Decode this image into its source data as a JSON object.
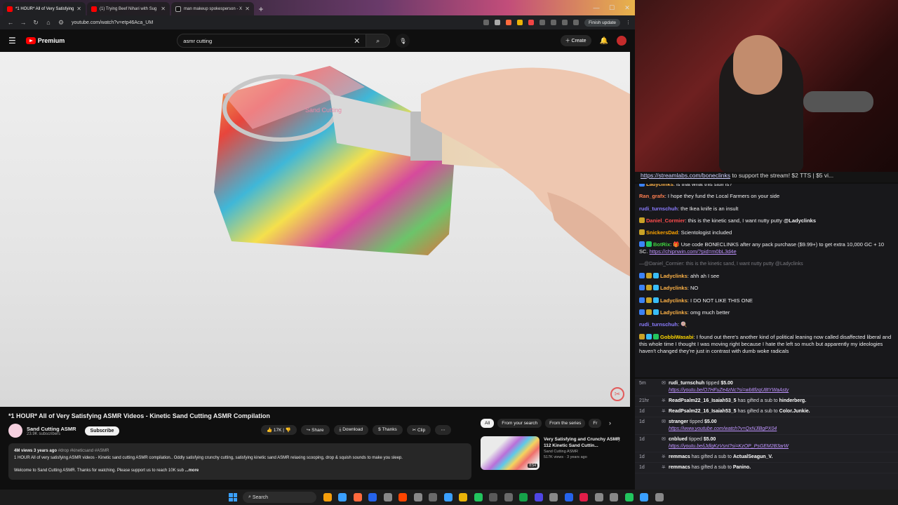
{
  "browser": {
    "tabs": [
      {
        "title": "*1 HOUR* All of Very Satisfying",
        "active": true,
        "icon": "youtube-icon"
      },
      {
        "title": "(1) Trying Beef Nihari with Sug",
        "active": false,
        "icon": "youtube-icon"
      },
      {
        "title": "man makeup spokesperson - X",
        "active": false,
        "icon": "x-icon"
      }
    ],
    "url": "youtube.com/watch?v=etp46Aca_UM",
    "finish_update": "Finish update"
  },
  "youtube": {
    "logo_text": "Premium",
    "search_value": "asmr cutting",
    "create_label": "Create"
  },
  "video": {
    "watermark": "Sand Cutting",
    "title": "*1 HOUR* All of Very Satisfying ASMR Videos - Kinetic Sand Cutting ASMR Compilation",
    "channel": "Sand Cutting ASMR",
    "subscribers": "23.9K subscribers",
    "subscribe_label": "Subscribe",
    "likes": "17K",
    "share_label": "Share",
    "download_label": "Download",
    "thanks_label": "Thanks",
    "clip_label": "Clip",
    "desc_meta": "4M views  3 years ago",
    "desc_tags": "#drop #kineticsand #ASMR",
    "desc_line1": "1 HOUR All of very satisfying ASMR videos - Kinetic sand cutting ASMR compilation.. Oddly satisfying crunchy cutting, satisfying kinetic sand ASMR relaxing scooping, drop & squish sounds to make you sleep.",
    "desc_line2": "Welcome to Sand Cutting ASMR. Thanks for watching. Please support us to reach 10K sub",
    "desc_more": "...more"
  },
  "recommended": {
    "chips": [
      "All",
      "From your search",
      "From the series",
      "Fr"
    ],
    "items": [
      {
        "title": "Very Satisfying and Crunchy ASMR 112 Kinetic Sand Cuttin...",
        "channel": "Sand Cutting ASMR",
        "meta": "517K views · 3 years ago",
        "duration": "8:54"
      }
    ]
  },
  "stream": {
    "banner_link": "https://streamlabs.com/boneclinks",
    "banner_text": " to support the stream! $2 TTS | $5 vi..."
  },
  "chat": [
    {
      "user": "Ladyclinks",
      "color": "#ffb347",
      "text": ": is that what this stuff is?",
      "badges": [
        "#3b82f6"
      ],
      "partial": true
    },
    {
      "user": "Ran_grafx",
      "color": "#ff7f50",
      "text": ": I hope they fund the Local Farmers on your side",
      "badges": []
    },
    {
      "user": "rudi_turnschuh",
      "color": "#8b7cff",
      "text": ": the Ikea knife is an insult",
      "badges": []
    },
    {
      "user": "Daniel_Cormier",
      "color": "#ff4d4d",
      "text": ": this is the kinetic sand, I want nutty putty ",
      "mention": "@Ladyclinks",
      "badges": [
        "#c9a227"
      ]
    },
    {
      "user": "SnickersDad",
      "color": "#ffa500",
      "text": ": Scientologist included",
      "badges": [
        "#c9a227"
      ]
    },
    {
      "user": "BotRix",
      "color": "#3fd13f",
      "text": ": 🎁 Use code BONECLINKS after any pack purchase ($9.99+) to get extra 10,000 GC + 10 SC. ",
      "link": "https://chipnwin.com/?pid=m0bL3d4e",
      "badges": [
        "#3b82f6",
        "#22c55e"
      ]
    },
    {
      "user": "",
      "color": "#7a7a80",
      "text": "—@Daniel_Cormier: this is the kinetic sand, I want nutty putty @Ladyclinks",
      "badges": [],
      "reply": true
    },
    {
      "user": "Ladyclinks",
      "color": "#ffb347",
      "text": ": ahh ah I see",
      "badges": [
        "#3b82f6",
        "#c9a227",
        "#38bdf8"
      ]
    },
    {
      "user": "Ladyclinks",
      "color": "#ffb347",
      "text": ": NO",
      "badges": [
        "#3b82f6",
        "#c9a227",
        "#38bdf8"
      ]
    },
    {
      "user": "Ladyclinks",
      "color": "#ffb347",
      "text": ": I DO NOT LIKE THIS ONE",
      "badges": [
        "#3b82f6",
        "#c9a227",
        "#38bdf8"
      ]
    },
    {
      "user": "Ladyclinks",
      "color": "#ffb347",
      "text": ": omg much better",
      "badges": [
        "#3b82f6",
        "#c9a227",
        "#38bdf8"
      ]
    },
    {
      "user": "rudi_turnschuh",
      "color": "#8b7cff",
      "text": ": 🍭",
      "badges": []
    },
    {
      "user": "GobbiWasabi",
      "color": "#ffd700",
      "text": ": I found out there's another kind of political leaning now called disaffected liberal and this whole time I thought I was moving right because I hate the left so much but apparently my ideologies haven't changed they're just in contrast with dumb woke radicals",
      "badges": [
        "#c9a227",
        "#38bdf8",
        "#22c55e"
      ]
    }
  ],
  "events": [
    {
      "time": "5m",
      "icon": "tip-icon",
      "user": "rudi_turnschuh",
      "action": " tipped ",
      "amount": "$5.00",
      "link": "https://youtu.be/O7HFuZe4zNc?si=wb8fzqU8tYWaAsty"
    },
    {
      "time": "21hr",
      "icon": "gift-icon",
      "user": "ReadPsalm22_16_Isaiah53_5",
      "action": " has gifted a sub to ",
      "target": "hinderberg."
    },
    {
      "time": "1d",
      "icon": "gift-icon",
      "user": "ReadPsalm22_16_Isaiah53_5",
      "action": " has gifted a sub to ",
      "target": "Color.Junkie."
    },
    {
      "time": "1d",
      "icon": "tip-icon",
      "user": "stranger",
      "action": " tipped ",
      "amount": "$5.00",
      "link": "https://www.youtube.com/watch?v=QxNJlBgPX04"
    },
    {
      "time": "1d",
      "icon": "tip-icon",
      "user": "cnblued",
      "action": " tipped ",
      "amount": "$5.00",
      "link": "https://youtu.be/jJdlgKzVsnI?si=KzOP_PsGEM2B3arW"
    },
    {
      "time": "1d",
      "icon": "gift-icon",
      "user": "remmacs",
      "action": " has gifted a sub to ",
      "target": "ActualSeagun_V."
    },
    {
      "time": "1d",
      "icon": "gift-icon",
      "user": "remmacs",
      "action": " has gifted a sub to ",
      "target": "Panino."
    }
  ],
  "taskbar": {
    "search_placeholder": "Search",
    "icons": [
      "#f59e0b",
      "#3aa0ff",
      "#ff6a3d",
      "#2563eb",
      "#888888",
      "#ff4500",
      "#888888",
      "#6a6a6a",
      "#3aa0ff",
      "#eab308",
      "#22c55e",
      "#5a5a5a",
      "#6a6a6a",
      "#16a34a",
      "#4f46e5",
      "#888888",
      "#2563eb",
      "#e11d48",
      "#888888",
      "#888888",
      "#22c55e",
      "#3aa0ff",
      "#888888"
    ]
  }
}
